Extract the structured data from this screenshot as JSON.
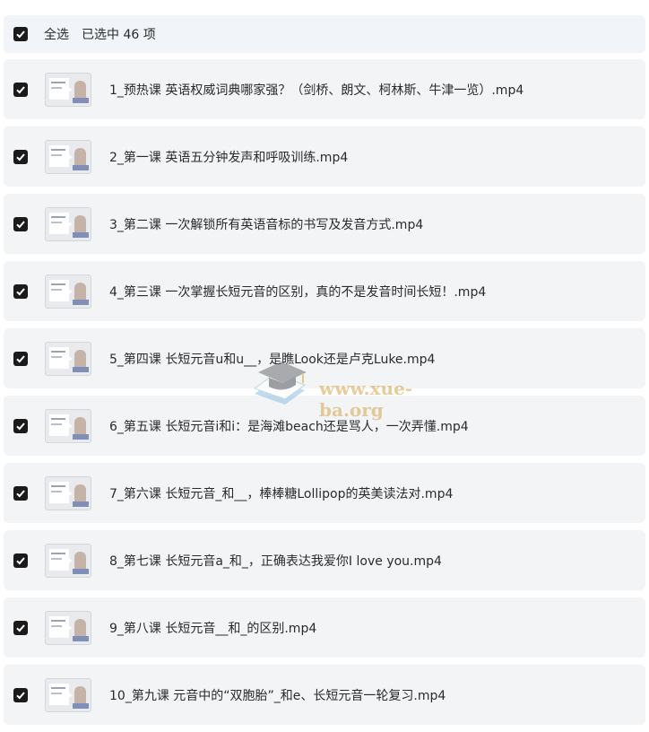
{
  "header": {
    "select_all_label": "全选",
    "selected_text": "已选中  46  项"
  },
  "files": [
    {
      "name": "1_预热课 英语权威词典哪家强？（剑桥、朗文、柯林斯、牛津一览）.mp4",
      "checked": true
    },
    {
      "name": "2_第一课 英语五分钟发声和呼吸训练.mp4",
      "checked": true
    },
    {
      "name": "3_第二课 一次解锁所有英语音标的书写及发音方式.mp4",
      "checked": true
    },
    {
      "name": "4_第三课 一次掌握长短元音的区别，真的不是发音时间长短！.mp4",
      "checked": true
    },
    {
      "name": "5_第四课 长短元音u和u__，是瞧Look还是卢克Luke.mp4",
      "checked": true
    },
    {
      "name": "6_第五课 长短元音i和i：是海滩beach还是骂人，一次弄懂.mp4",
      "checked": true
    },
    {
      "name": "7_第六课 长短元音_和__，棒棒糖Lollipop的英美读法对.mp4",
      "checked": true
    },
    {
      "name": "8_第七课 长短元音a_和_，正确表达我爱你I love you.mp4",
      "checked": true
    },
    {
      "name": "9_第八课 长短元音__和_的区别.mp4",
      "checked": true
    },
    {
      "name": "10_第九课 元音中的“双胞胎”_和e、长短元音一轮复习.mp4",
      "checked": true
    }
  ],
  "icons": {
    "checkbox": "checkmark-icon",
    "thumbnail": "video-thumbnail-icon",
    "watermark": "graduation-cap-logo"
  },
  "watermark": {
    "text": "www.xue-ba.org"
  },
  "colors": {
    "checkbox_fill": "#1b1b1b",
    "row_bg": "#f3f4f6",
    "header_bg": "#f1f4f9",
    "watermark": "#d7a54a"
  }
}
